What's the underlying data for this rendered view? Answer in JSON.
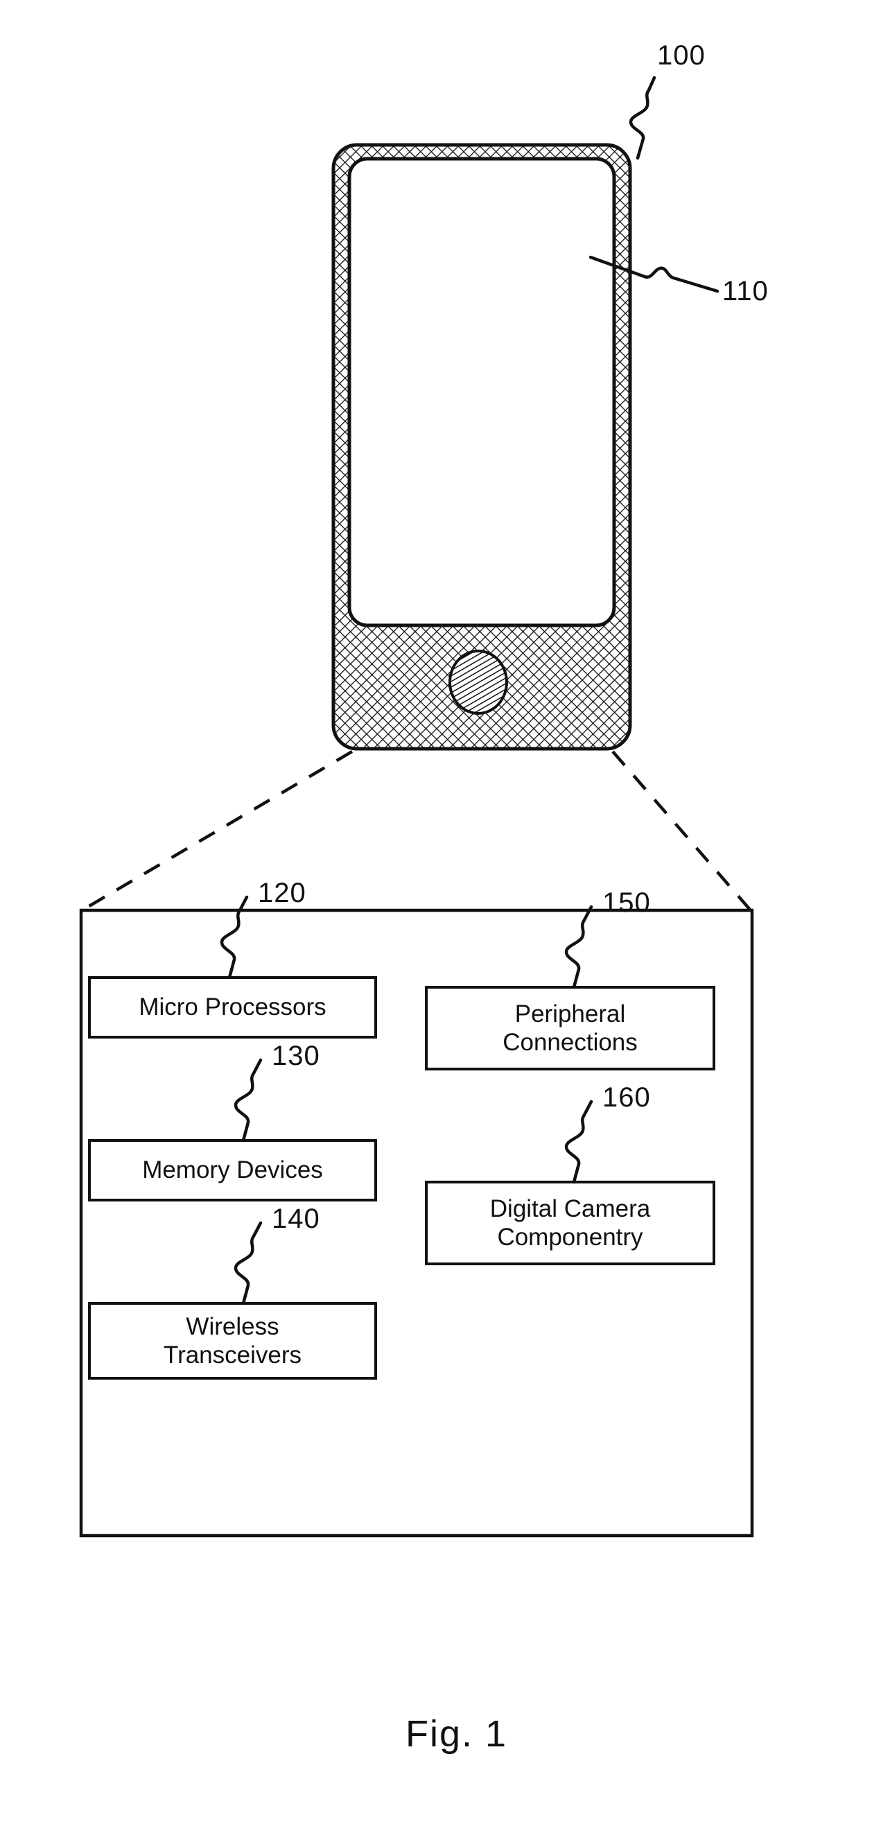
{
  "figure": {
    "caption": "Fig. 1",
    "device": {
      "reference_numeral": "100",
      "screen_reference_numeral": "110",
      "home_button_name": "home-button"
    },
    "detail_box": {
      "components": [
        {
          "ref": "120",
          "label": "Micro Processors",
          "column": "left",
          "name": "micro-processors"
        },
        {
          "ref": "130",
          "label": "Memory Devices",
          "column": "left",
          "name": "memory-devices"
        },
        {
          "ref": "140",
          "label": "Wireless\nTransceivers",
          "column": "left",
          "name": "wireless-transceivers"
        },
        {
          "ref": "150",
          "label": "Peripheral\nConnections",
          "column": "right",
          "name": "peripheral-connections"
        },
        {
          "ref": "160",
          "label": "Digital Camera\nComponentry",
          "column": "right",
          "name": "digital-camera-componentry"
        }
      ]
    },
    "colors": {
      "ink": "#111111",
      "paper": "#ffffff",
      "hatch": "#1a1a1a"
    }
  }
}
